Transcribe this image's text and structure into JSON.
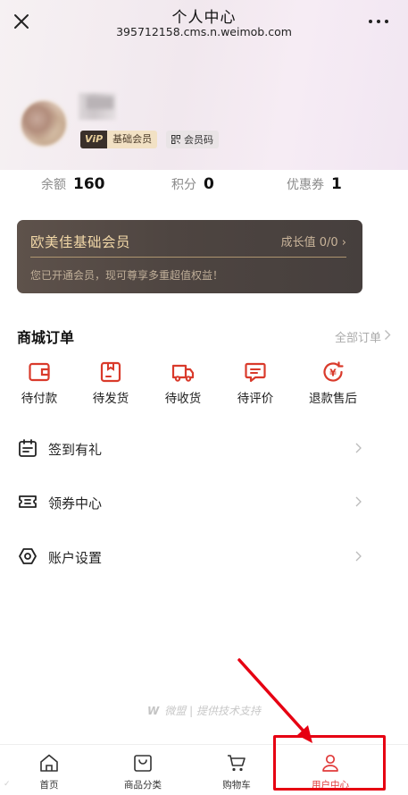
{
  "header": {
    "title": "个人中心",
    "url": "395712158.cms.n.weimob.com"
  },
  "profile": {
    "vip_tag": "ViP",
    "level_label": "基础会员",
    "member_code_label": "会员码"
  },
  "stats": [
    {
      "label": "余额",
      "value": "160"
    },
    {
      "label": "积分",
      "value": "0"
    },
    {
      "label": "优惠券",
      "value": "1"
    }
  ],
  "member_card": {
    "name": "欧美佳基础会员",
    "growth": "成长值 0/0 ›",
    "description": "您已开通会员，现可尊享多重超值权益！"
  },
  "orders": {
    "title": "商城订单",
    "all_label": "全部订单",
    "items": [
      {
        "label": "待付款",
        "icon": "wallet-icon"
      },
      {
        "label": "待发货",
        "icon": "package-icon"
      },
      {
        "label": "待收货",
        "icon": "truck-icon"
      },
      {
        "label": "待评价",
        "icon": "comment-icon"
      },
      {
        "label": "退款售后",
        "icon": "refund-icon"
      }
    ]
  },
  "menu": [
    {
      "label": "签到有礼",
      "icon": "calendar-icon"
    },
    {
      "label": "领券中心",
      "icon": "coupon-icon"
    },
    {
      "label": "账户设置",
      "icon": "settings-icon"
    }
  ],
  "footer": {
    "brand": "微盟",
    "tagline": "提供技术支持"
  },
  "tabbar": [
    {
      "label": "首页",
      "icon": "home-icon"
    },
    {
      "label": "商品分类",
      "icon": "category-icon"
    },
    {
      "label": "购物车",
      "icon": "cart-icon"
    },
    {
      "label": "用户中心",
      "icon": "user-icon",
      "active": true
    }
  ],
  "colors": {
    "accent": "#e03a3a",
    "highlight": "#e60012",
    "card_gold": "#f1d7a7",
    "order_icon": "#d93a2b"
  }
}
